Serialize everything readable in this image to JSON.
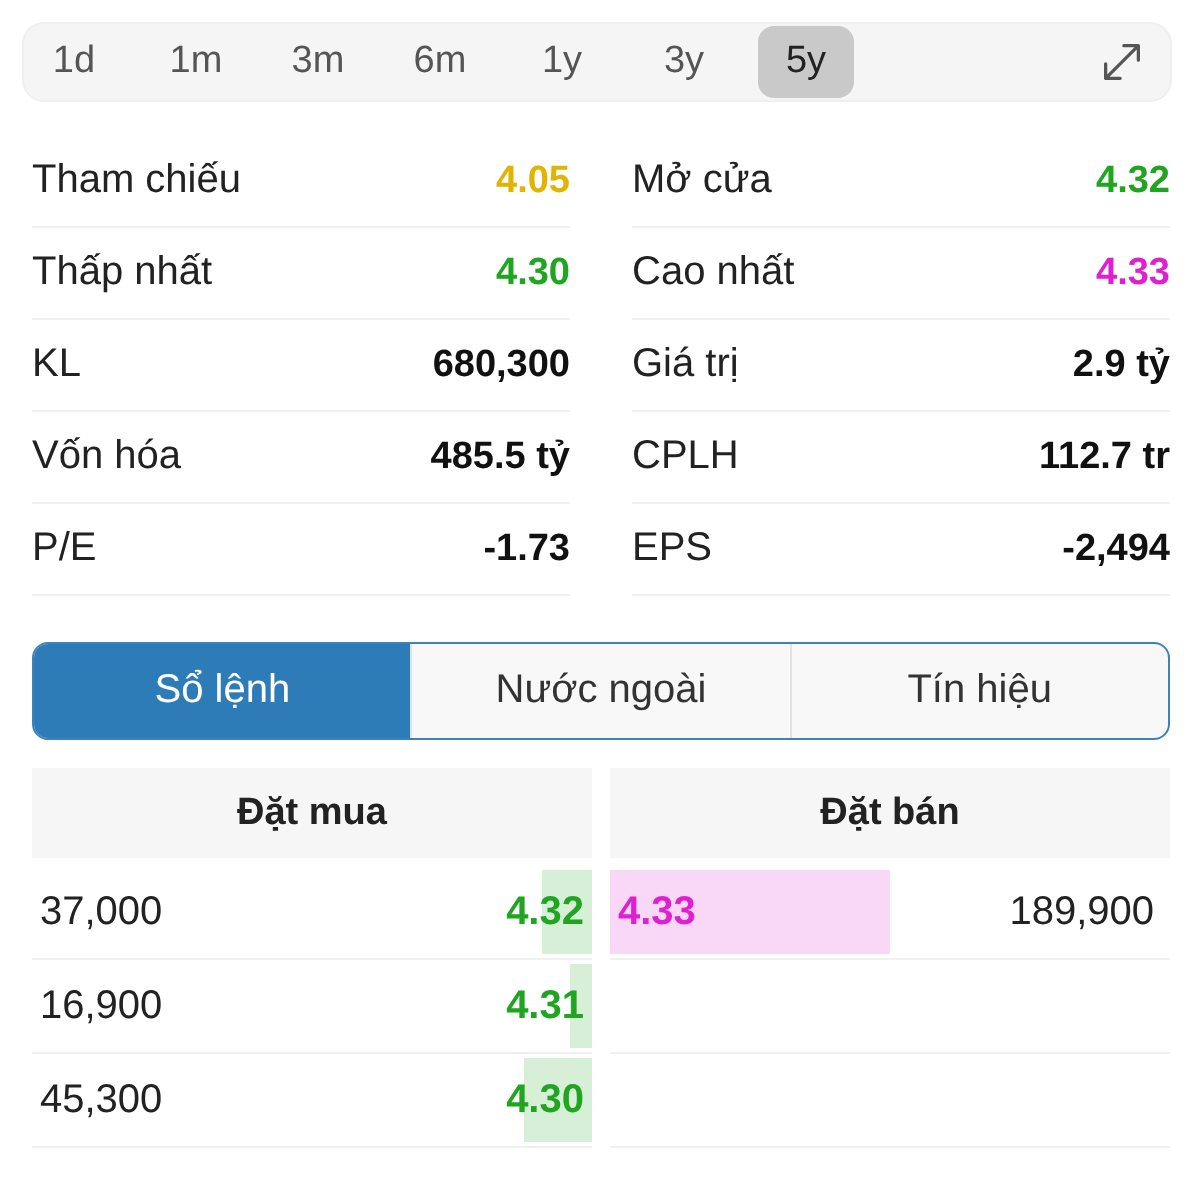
{
  "periods": [
    {
      "label": "1d",
      "selected": false
    },
    {
      "label": "1m",
      "selected": false
    },
    {
      "label": "3m",
      "selected": false
    },
    {
      "label": "6m",
      "selected": false
    },
    {
      "label": "1y",
      "selected": false
    },
    {
      "label": "3y",
      "selected": false
    },
    {
      "label": "5y",
      "selected": true
    }
  ],
  "stats": [
    {
      "label": "Tham chiếu",
      "value": "4.05",
      "color": "#e0b400"
    },
    {
      "label": "Mở cửa",
      "value": "4.32",
      "color": "#1fa51f"
    },
    {
      "label": "Thấp nhất",
      "value": "4.30",
      "color": "#1fa51f"
    },
    {
      "label": "Cao nhất",
      "value": "4.33",
      "color": "#e020d0"
    },
    {
      "label": "KL",
      "value": "680,300"
    },
    {
      "label": "Giá trị",
      "value": "2.9 tỷ"
    },
    {
      "label": "Vốn hóa",
      "value": "485.5 tỷ"
    },
    {
      "label": "CPLH",
      "value": "112.7 tr"
    },
    {
      "label": "P/E",
      "value": "-1.73"
    },
    {
      "label": "EPS",
      "value": "-2,494"
    }
  ],
  "tabs": [
    {
      "label": "Sổ lệnh",
      "selected": true
    },
    {
      "label": "Nước ngoài",
      "selected": false
    },
    {
      "label": "Tín hiệu",
      "selected": false
    }
  ],
  "order_book": {
    "columns": [
      "Đặt mua",
      "Đặt bán"
    ],
    "bids": [
      {
        "volume": "37,000",
        "price": "4.32",
        "color": "#1fa51f",
        "level": 0.09
      },
      {
        "volume": "16,900",
        "price": "4.31",
        "color": "#1fa51f",
        "level": 0.04
      },
      {
        "volume": "45,300",
        "price": "4.30",
        "color": "#1fa51f",
        "level": 0.12
      }
    ],
    "asks": [
      {
        "price": "4.33",
        "volume": "189,900",
        "color": "#e020d0",
        "level": 0.5
      }
    ]
  }
}
